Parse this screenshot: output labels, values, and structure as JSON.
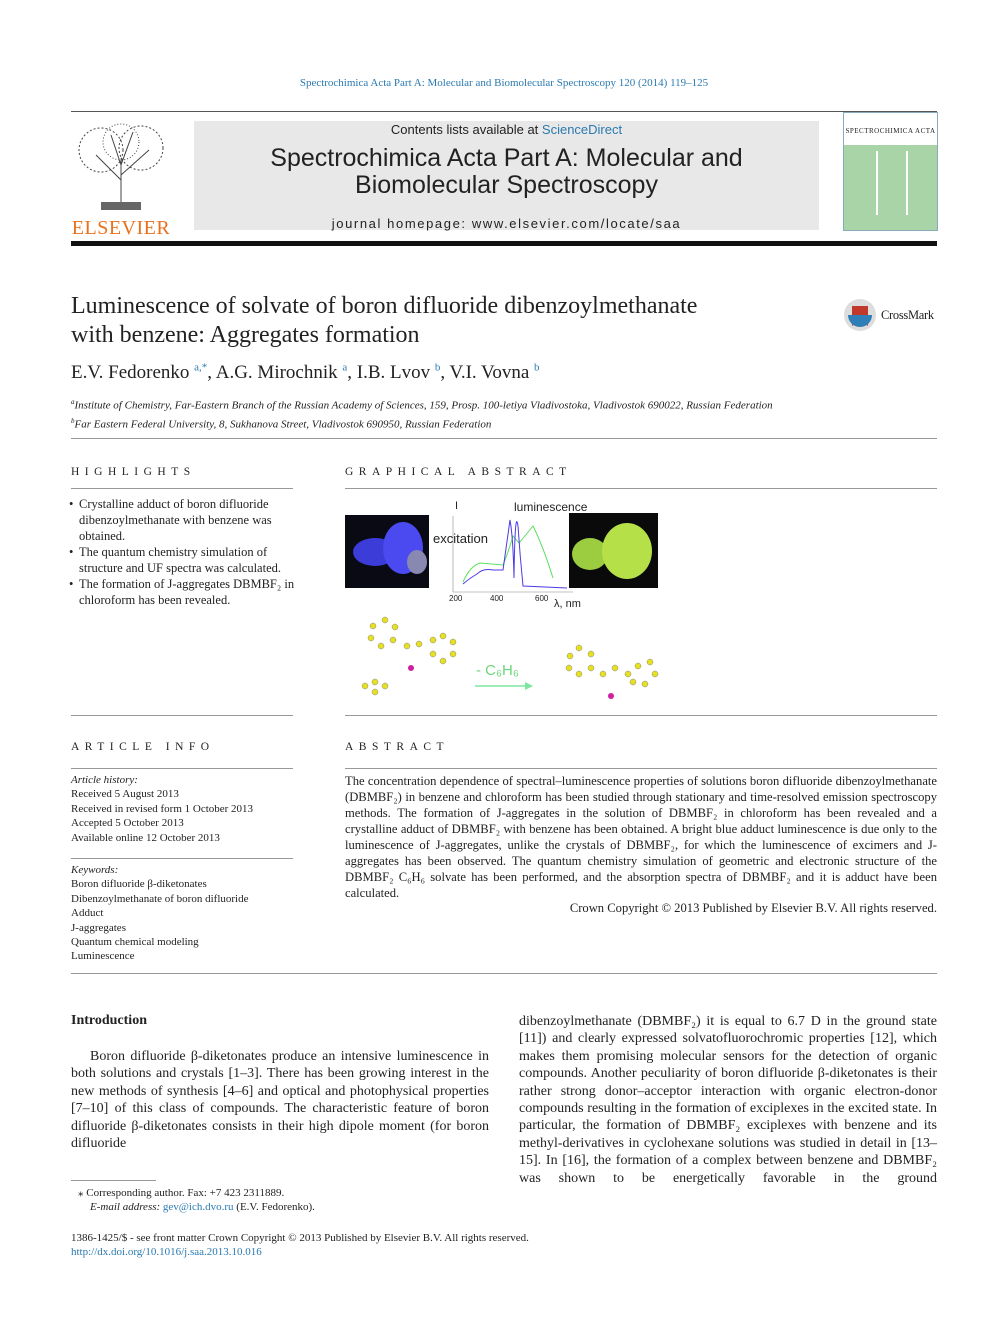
{
  "journal_ref": "Spectrochimica Acta Part A: Molecular and Biomolecular Spectroscopy 120 (2014) 119–125",
  "header": {
    "contents_prefix": "Contents lists available at ",
    "contents_link": "ScienceDirect",
    "journal_title_1": "Spectrochimica Acta Part A: Molecular and",
    "journal_title_2": "Biomolecular Spectroscopy",
    "homepage": "journal homepage: www.elsevier.com/locate/saa",
    "publisher": "ELSEVIER",
    "cover_title": "SPECTROCHIMICA ACTA"
  },
  "title_1": "Luminescence of solvate of boron difluoride dibenzoylmethanate",
  "title_2": "with benzene: Aggregates formation",
  "crossmark": "CrossMark",
  "authors": [
    {
      "name": "E.V. Fedorenko",
      "sup": "a,*"
    },
    {
      "name": ", A.G. Mirochnik",
      "sup": "a"
    },
    {
      "name": ", I.B. Lvov",
      "sup": "b"
    },
    {
      "name": ", V.I. Vovna",
      "sup": "b"
    }
  ],
  "affiliations": [
    {
      "sup": "a",
      "text": "Institute of Chemistry, Far-Eastern Branch of the Russian Academy of Sciences, 159, Prosp. 100-letiya Vladivostoka, Vladivostok 690022, Russian Federation"
    },
    {
      "sup": "b",
      "text": "Far Eastern Federal University, 8, Sukhanova Street, Vladivostok 690950, Russian Federation"
    }
  ],
  "highlights": {
    "heading": "HIGHLIGHTS",
    "items": [
      "Crystalline adduct of boron difluoride dibenzoylmethanate with benzene was obtained.",
      "The quantum chemistry simulation of structure and UF spectra was calculated.",
      "The formation of J-aggregates DBMBF₂ in chloroform has been revealed."
    ]
  },
  "graphical_abstract": {
    "heading": "GRAPHICAL ABSTRACT",
    "y_label": "I",
    "luminescence": "luminescence",
    "excitation": "excitation",
    "ticks": [
      "200",
      "400",
      "600"
    ],
    "x_label": "λ, nm",
    "arrow_label": "- C₆H₆"
  },
  "article_info": {
    "heading": "ARTICLE INFO",
    "history_label": "Article history:",
    "history": [
      "Received 5 August 2013",
      "Received in revised form 1 October 2013",
      "Accepted 5 October 2013",
      "Available online 12 October 2013"
    ],
    "keywords_label": "Keywords:",
    "keywords": [
      "Boron difluoride β-diketonates",
      "Dibenzoylmethanate of boron difluoride",
      "Adduct",
      "J-aggregates",
      "Quantum chemical modeling",
      "Luminescence"
    ]
  },
  "abstract": {
    "heading": "ABSTRACT",
    "text": "The concentration dependence of spectral–luminescence properties of solutions boron difluoride dibenzoylmethanate (DBMBF₂) in benzene and chloroform has been studied through stationary and time-resolved emission spectroscopy methods. The formation of J-aggregates in the solution of DBMBF₂ in chloroform has been revealed and a crystalline adduct of DBMBF₂ with benzene has been obtained. A bright blue adduct luminescence is due only to the luminescence of J-aggregates, unlike the crystals of DBMBF₂, for which the luminescence of excimers and J-aggregates has been observed. The quantum chemistry simulation of geometric and electronic structure of the DBMBF₂ C₆H₆ solvate has been performed, and the absorption spectra of DBMBF₂ and it is adduct have been calculated.",
    "copyright": "Crown Copyright © 2013 Published by Elsevier B.V. All rights reserved."
  },
  "intro": {
    "heading": "Introduction",
    "left": "Boron difluoride β-diketonates produce an intensive luminescence in both solutions and crystals [1–3]. There has been growing interest in the new methods of synthesis [4–6] and optical and photophysical properties [7–10] of this class of compounds. The characteristic feature of boron difluoride β-diketonates consists in their high dipole moment (for boron difluoride",
    "right": "dibenzoylmethanate (DBMBF₂) it is equal to 6.7 D in the ground state [11]) and clearly expressed solvatofluorochromic properties [12], which makes them promising molecular sensors for the detection of organic compounds. Another peculiarity of boron difluoride β-diketonates is their rather strong donor–acceptor interaction with organic electron-donor compounds resulting in the formation of exciplexes in the excited state. In particular, the formation of DBMBF₂ exciplexes with benzene and its methyl-derivatives in cyclohexane solutions was studied in detail in [13–15]. In [16], the formation of a complex between benzene and DBMBF₂ was shown to be energetically favorable in the ground"
  },
  "footnote": {
    "corresponding": "Corresponding author. Fax: +7 423 2311889.",
    "email_label": "E-mail address: ",
    "email": "gev@ich.dvo.ru",
    "email_name": " (E.V. Fedorenko)."
  },
  "front_matter": "1386-1425/$ - see front matter Crown Copyright © 2013 Published by Elsevier B.V. All rights reserved.",
  "doi": "http://dx.doi.org/10.1016/j.saa.2013.10.016"
}
